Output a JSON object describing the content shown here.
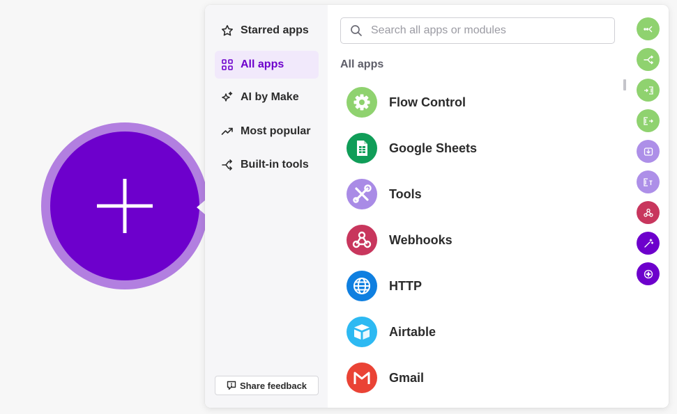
{
  "colors": {
    "brand_purple": "#6d00cc",
    "brand_purple_light": "#b27fe0",
    "active_bg": "#f1e9fb",
    "flow_green": "#8fd26f",
    "rail_lavender": "#ad8fe8",
    "webhook_red": "#c8365d"
  },
  "add_button": {
    "icon": "plus-icon"
  },
  "sidebar": {
    "items": [
      {
        "label": "Starred apps",
        "icon": "star-icon",
        "active": false
      },
      {
        "label": "All apps",
        "icon": "grid-icon",
        "active": true
      },
      {
        "label": "AI by Make",
        "icon": "sparkles-icon",
        "active": false
      },
      {
        "label": "Most popular",
        "icon": "trending-up-icon",
        "active": false
      },
      {
        "label": "Built-in tools",
        "icon": "branch-icon",
        "active": false
      }
    ],
    "feedback_label": "Share feedback",
    "feedback_icon": "message-icon"
  },
  "search": {
    "placeholder": "Search all apps or modules",
    "value": ""
  },
  "main": {
    "section_title": "All apps",
    "apps": [
      {
        "name": "Flow Control",
        "icon": "gear-icon",
        "color": "#8fd26f"
      },
      {
        "name": "Google Sheets",
        "icon": "spreadsheet-icon",
        "color": "#109d58"
      },
      {
        "name": "Tools",
        "icon": "wrench-screwdriver-icon",
        "color": "#a98be6"
      },
      {
        "name": "Webhooks",
        "icon": "webhook-icon",
        "color": "#c8365d"
      },
      {
        "name": "HTTP",
        "icon": "globe-icon",
        "color": "#0f7fe0"
      },
      {
        "name": "Airtable",
        "icon": "airtable-box-icon",
        "color": "#2db9f2"
      },
      {
        "name": "Gmail",
        "icon": "gmail-m-icon",
        "color": "#ea4335"
      }
    ]
  },
  "rail": {
    "buttons": [
      {
        "icon": "dots-route-icon",
        "color": "#8fd26f"
      },
      {
        "icon": "router-split-icon",
        "color": "#8fd26f"
      },
      {
        "icon": "iterator-in-icon",
        "color": "#8fd26f"
      },
      {
        "icon": "aggregator-out-icon",
        "color": "#8fd26f"
      },
      {
        "icon": "download-box-icon",
        "color": "#ad8fe8"
      },
      {
        "icon": "text-aggregator-icon",
        "color": "#ad8fe8"
      },
      {
        "icon": "webhook-icon",
        "color": "#c8365d"
      },
      {
        "icon": "magic-wand-icon",
        "color": "#6d00cc"
      },
      {
        "icon": "ai-plus-icon",
        "color": "#6d00cc"
      }
    ]
  }
}
